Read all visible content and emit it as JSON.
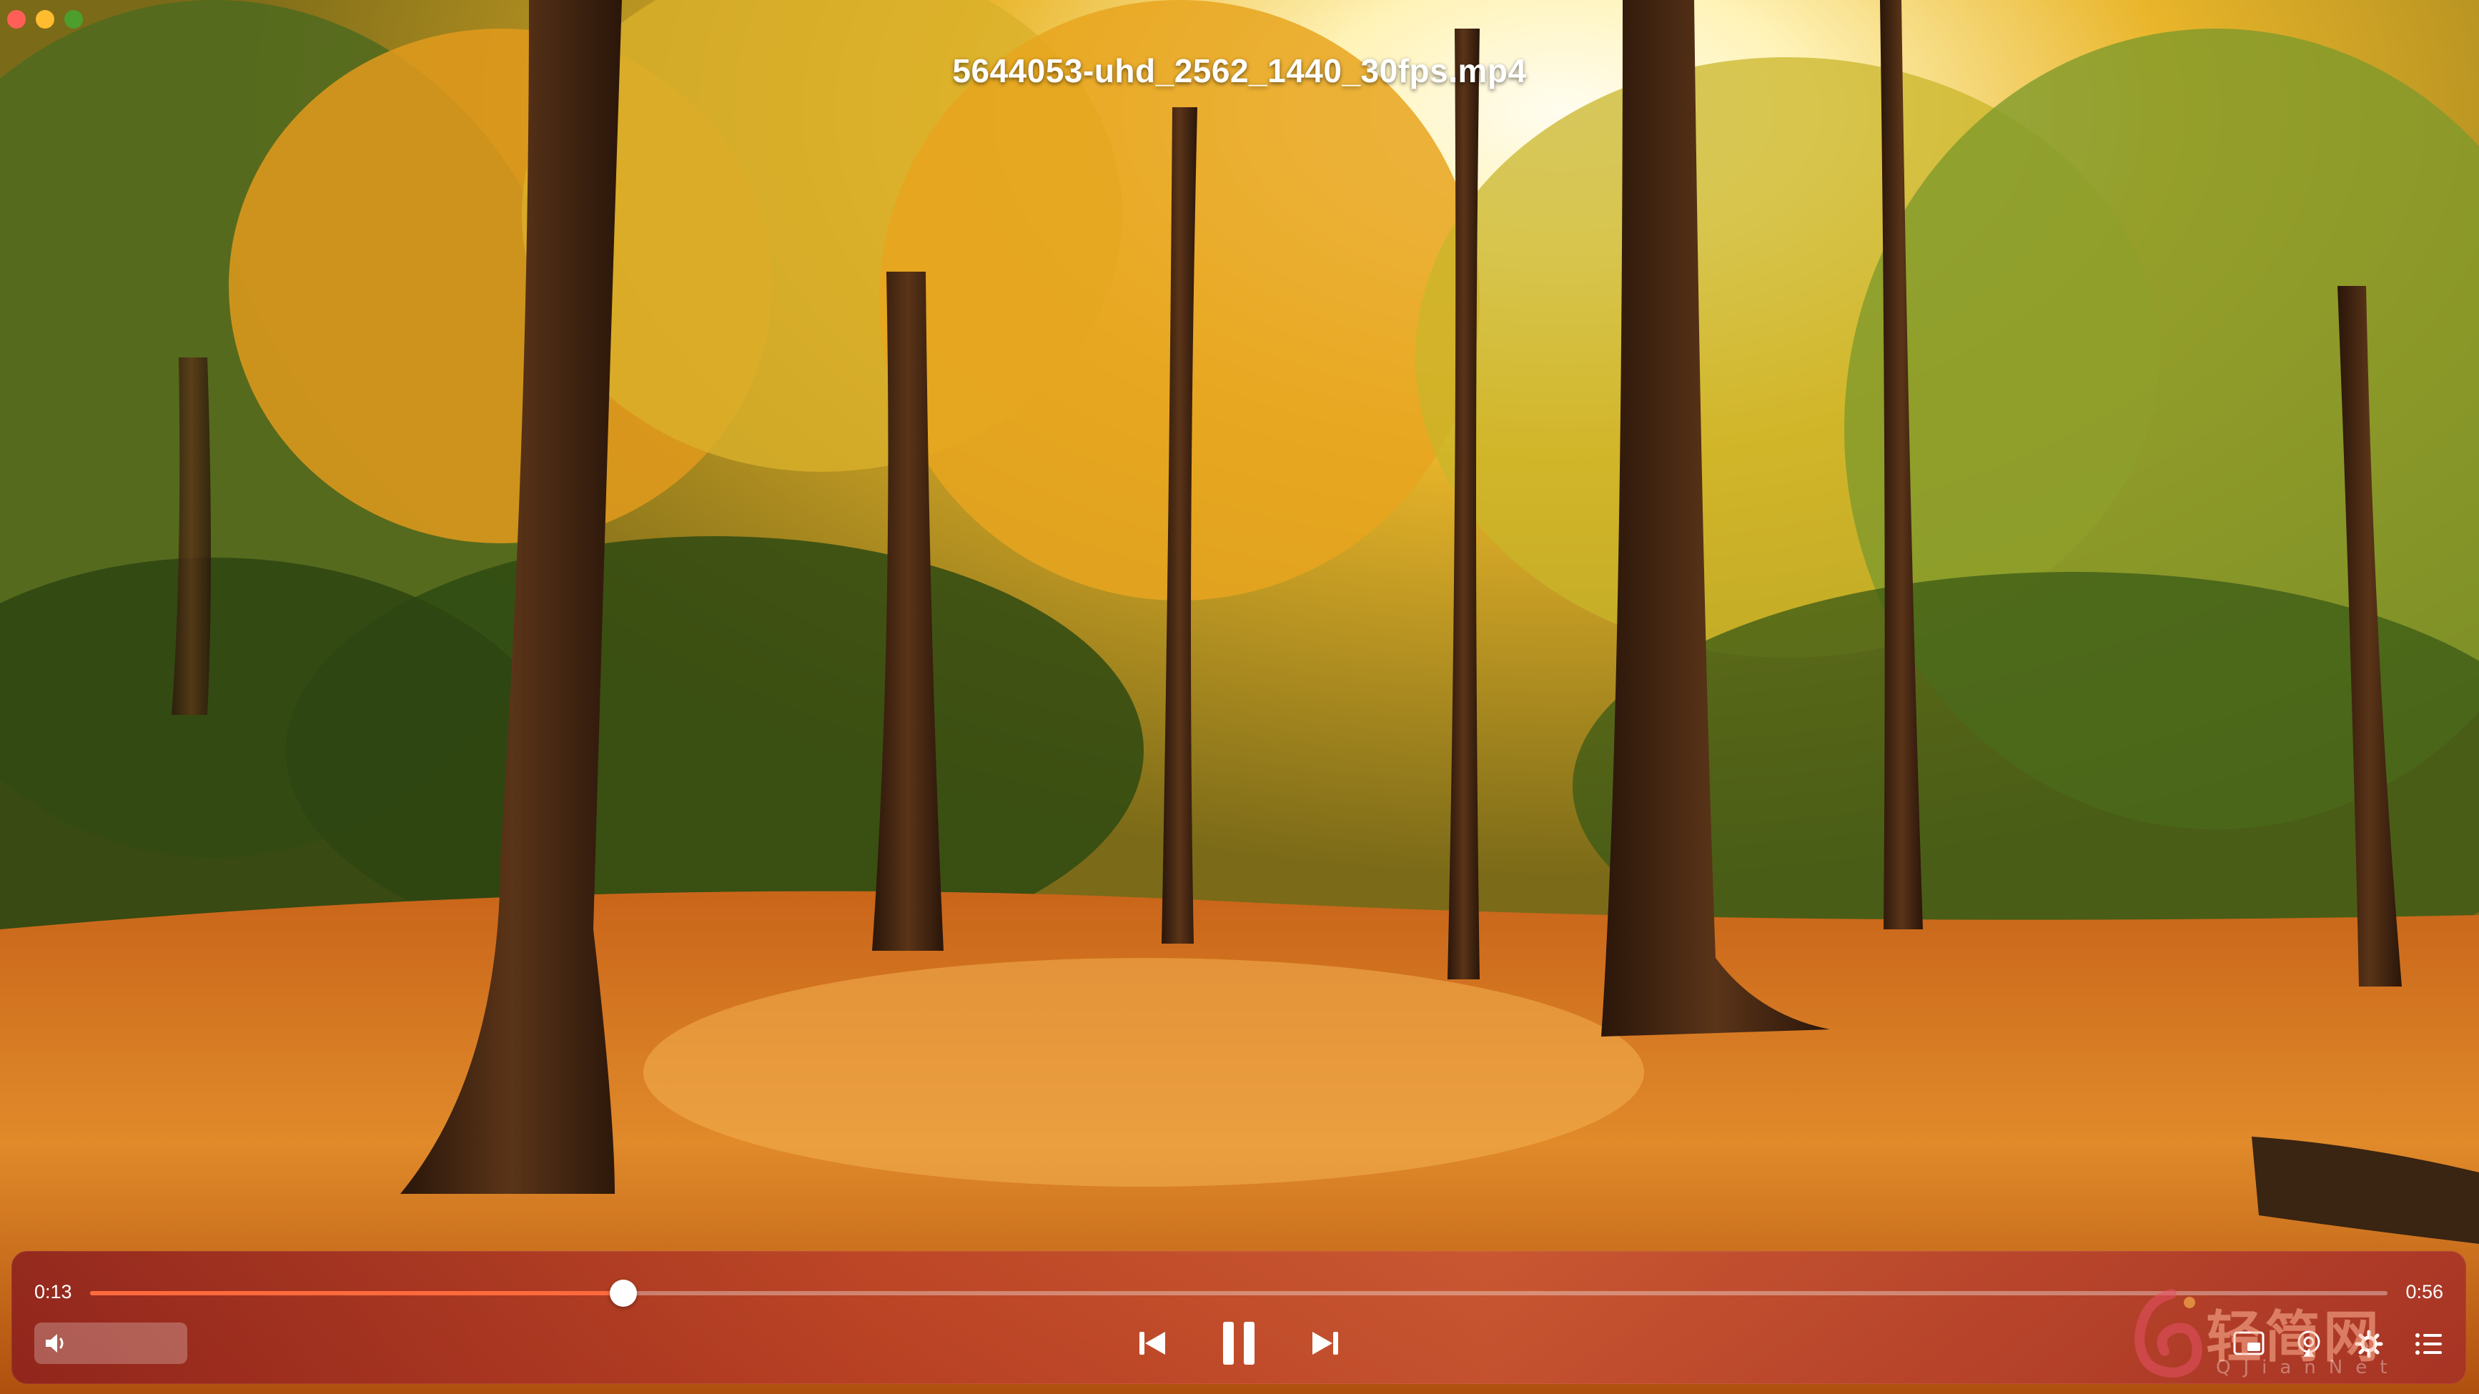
{
  "window": {
    "title": "5644053-uhd_2562_1440_30fps.mp4"
  },
  "player": {
    "elapsed": "0:13",
    "duration": "0:56",
    "progress_fraction": 0.232,
    "volume_fraction": 0.0
  },
  "controls": {
    "icons": [
      "speaker-icon",
      "previous-icon",
      "pause-icon",
      "next-icon",
      "picture-in-picture-icon",
      "airplay-icon",
      "settings-icon",
      "playlist-icon"
    ]
  },
  "watermark": {
    "text": "轻简网",
    "sub": "QJianNet"
  },
  "colors": {
    "progress": "#ff6a3d",
    "bar_left": "#8c1e1e",
    "bar_right": "#a52d28"
  }
}
